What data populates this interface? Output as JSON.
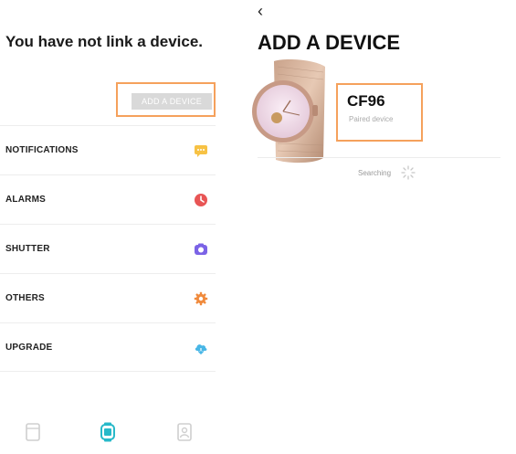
{
  "left": {
    "title": "You have not link a device.",
    "add_device_button": "ADD A DEVICE",
    "menu": [
      {
        "label": "NOTIFICATIONS",
        "icon": "message-icon",
        "color": "#f7c244"
      },
      {
        "label": "ALARMS",
        "icon": "clock-icon",
        "color": "#e85555"
      },
      {
        "label": "SHUTTER",
        "icon": "camera-icon",
        "color": "#7b63e6"
      },
      {
        "label": "OTHERS",
        "icon": "gear-icon",
        "color": "#f08a3c"
      },
      {
        "label": "UPGRADE",
        "icon": "cloud-download-icon",
        "color": "#48b6e6"
      }
    ],
    "tabs": [
      {
        "icon": "page-icon",
        "active": false
      },
      {
        "icon": "watch-icon",
        "active": true
      },
      {
        "icon": "profile-icon",
        "active": false
      }
    ],
    "accent": "#27b9c9"
  },
  "right": {
    "back": "‹",
    "title": "ADD A DEVICE",
    "device_name": "CF96",
    "device_status": "Paired device",
    "searching": "Searching",
    "highlight_color": "#f5a15c"
  }
}
